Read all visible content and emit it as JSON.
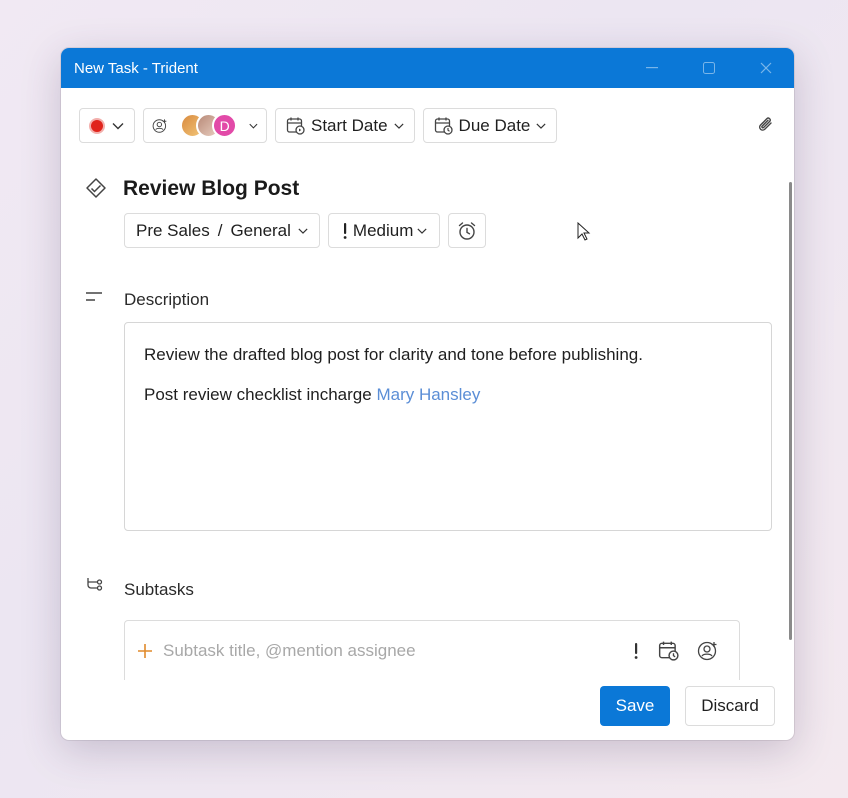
{
  "window": {
    "title": "New Task - Trident"
  },
  "toolbar": {
    "start_date_label": "Start Date",
    "due_date_label": "Due Date",
    "avatar_initial": "D"
  },
  "task": {
    "title": "Review Blog Post",
    "project": "Pre Sales",
    "separator": "/",
    "bucket": "General",
    "priority_label": "Medium"
  },
  "description": {
    "label": "Description",
    "line1": "Review the drafted blog post for clarity and tone before publishing.",
    "line2_prefix": "Post review checklist incharge",
    "mention": "Mary Hansley"
  },
  "subtasks": {
    "label": "Subtasks",
    "placeholder": "Subtask title, @mention assignee"
  },
  "footer": {
    "save_label": "Save",
    "discard_label": "Discard"
  },
  "colors": {
    "accent": "#0b78d7",
    "status": "#e0241c",
    "mention": "#5b8ed6"
  }
}
